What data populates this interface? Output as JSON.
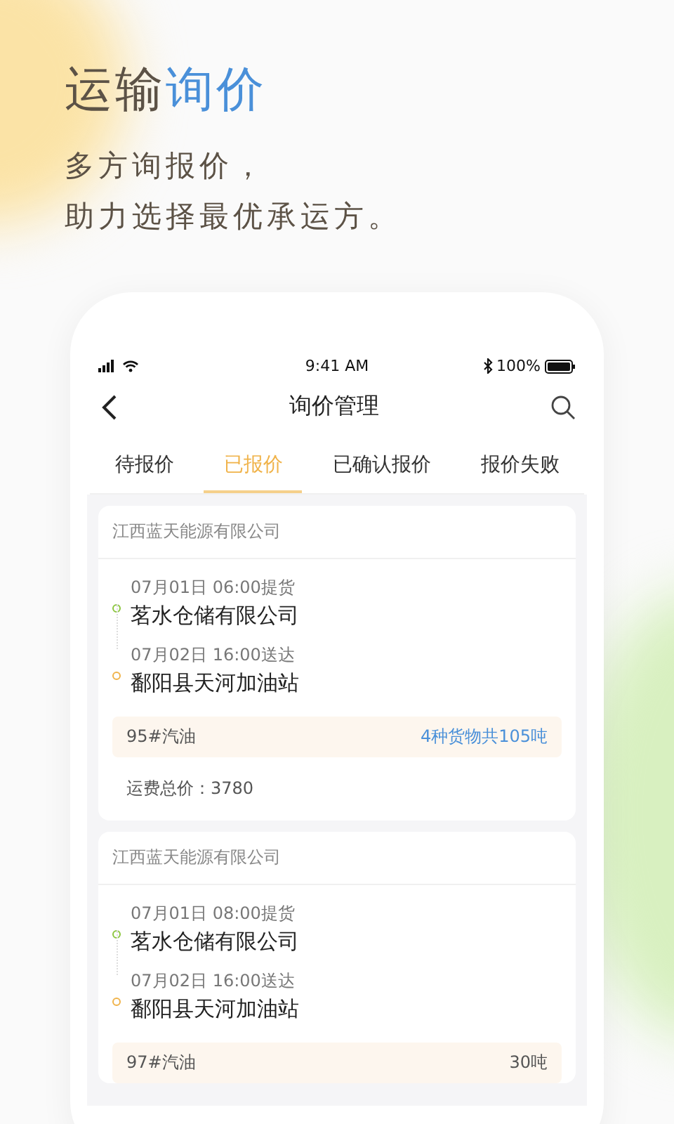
{
  "headline": [
    {
      "text": "运输",
      "kind": "plain"
    },
    {
      "text": "询价",
      "kind": "accent"
    }
  ],
  "subtitle": [
    "多方询报价，",
    "助力选择最优承运方。"
  ],
  "status_bar": {
    "time": "9:41 AM",
    "battery": "100%"
  },
  "nav": {
    "title": "询价管理"
  },
  "tabs": [
    {
      "label": "待报价",
      "selected": false
    },
    {
      "label": "已报价",
      "selected": true
    },
    {
      "label": "已确认报价",
      "selected": false
    },
    {
      "label": "报价失败",
      "selected": false
    }
  ],
  "cards": [
    {
      "company": "江西蓝天能源有限公司",
      "stops": [
        {
          "kind": "pickup",
          "time": "07月01日 06:00提货",
          "place": "茗水仓储有限公司"
        },
        {
          "kind": "delivery",
          "time": "07月02日 16:00送达",
          "place": "鄱阳县天河加油站"
        }
      ],
      "cargo": "95#汽油",
      "quantity": "4种货物共105吨",
      "quantity_link": true,
      "price": "运费总价：3780"
    },
    {
      "company": "江西蓝天能源有限公司",
      "stops": [
        {
          "kind": "pickup",
          "time": "07月01日 08:00提货",
          "place": "茗水仓储有限公司"
        },
        {
          "kind": "delivery",
          "time": "07月02日 16:00送达",
          "place": "鄱阳县天河加油站"
        }
      ],
      "cargo": "97#汽油",
      "quantity": "30吨",
      "quantity_link": false
    }
  ]
}
